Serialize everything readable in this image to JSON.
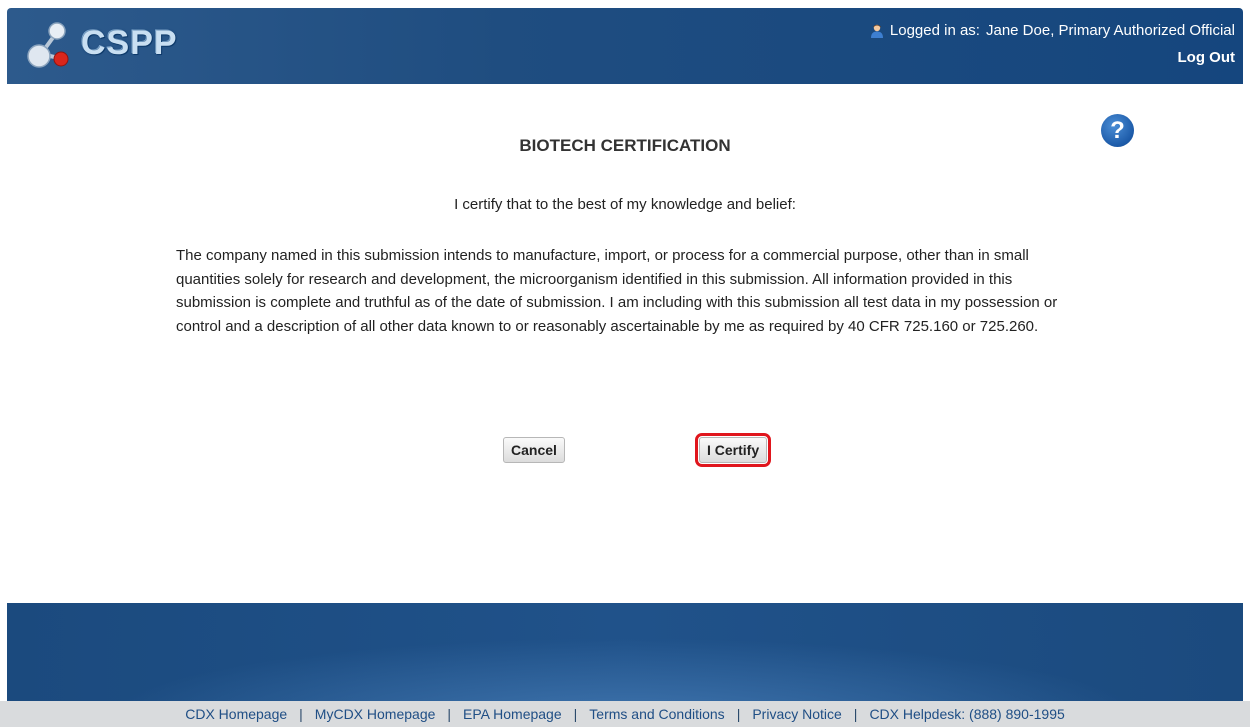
{
  "header": {
    "logo_text": "CSPP",
    "logged_in_prefix": "Logged in as:",
    "user_name": "Jane Doe, Primary Authorized Official",
    "logout_label": "Log Out"
  },
  "page": {
    "help_symbol": "?",
    "title": "BIOTECH CERTIFICATION",
    "intro": "I certify that to the best of my knowledge and belief:",
    "statement": "The company named in this submission intends to manufacture, import, or process for a commercial purpose, other than in small quantities solely for research and development, the microorganism identified in this submission. All information provided in this submission is complete and truthful as of the date of submission. I am including with this submission all test data in my possession or control and a description of all other data known to or reasonably ascertainable by me as required by 40 CFR 725.160 or 725.260."
  },
  "buttons": {
    "cancel": "Cancel",
    "certify": "I Certify"
  },
  "footer": {
    "separator": "|",
    "links": [
      "CDX Homepage",
      "MyCDX Homepage",
      "EPA Homepage",
      "Terms and Conditions",
      "Privacy Notice",
      "CDX Helpdesk: (888) 890-1995"
    ]
  },
  "colors": {
    "header_bg": "#1f4d80",
    "highlight": "#e0161d",
    "link": "#1f4e85"
  }
}
